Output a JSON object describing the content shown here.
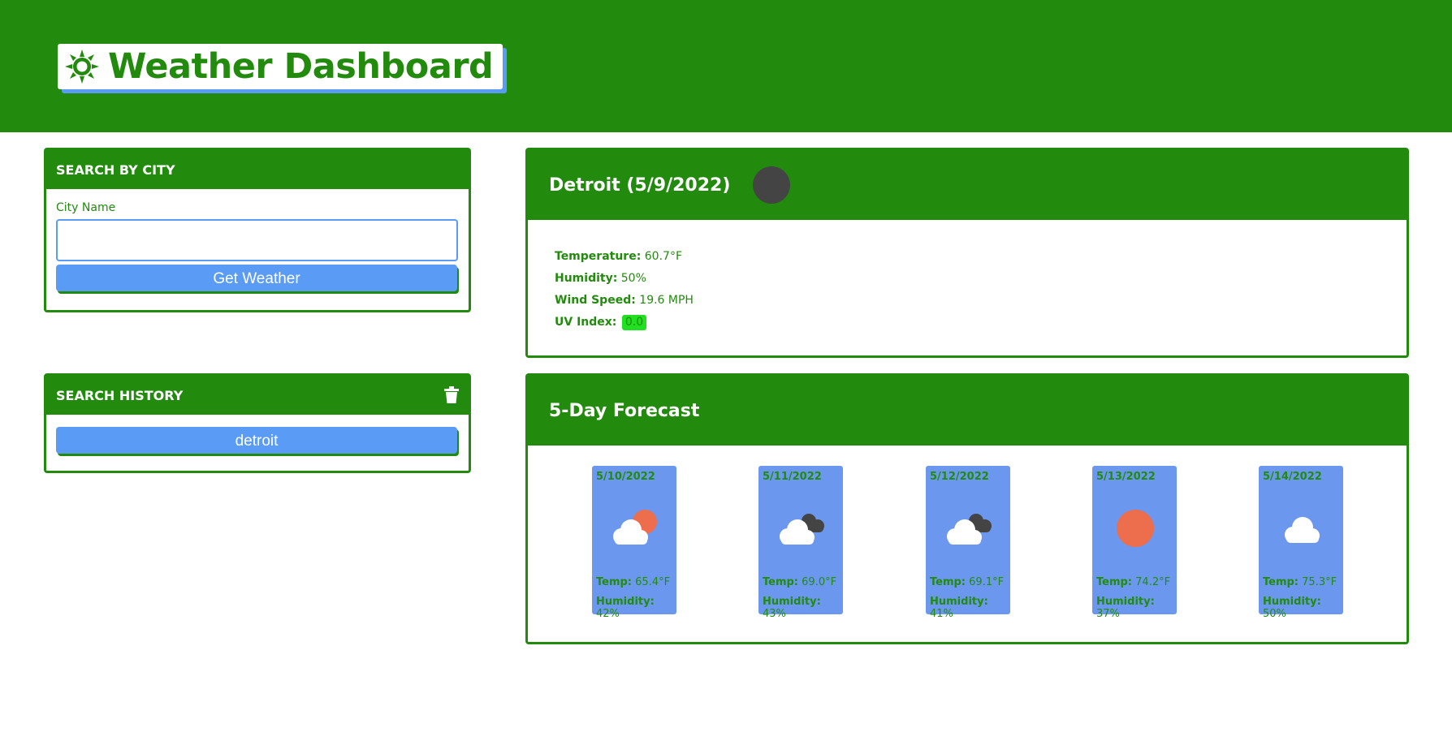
{
  "header": {
    "title": "Weather Dashboard",
    "icon": "sun-icon"
  },
  "search": {
    "title": "SEARCH BY CITY",
    "field_label": "City Name",
    "input_value": "",
    "button_label": "Get Weather"
  },
  "history": {
    "title": "SEARCH HISTORY",
    "clear_icon": "trash-icon",
    "items": [
      "detroit"
    ]
  },
  "current": {
    "heading": "Detroit (5/9/2022)",
    "icon": "weather-icon",
    "temperature_label": "Temperature:",
    "temperature_value": "60.7°F",
    "humidity_label": "Humidity:",
    "humidity_value": "50%",
    "wind_label": "Wind Speed:",
    "wind_value": "19.6 MPH",
    "uv_label": "UV Index:",
    "uv_value": "0.0"
  },
  "forecast": {
    "title": "5-Day Forecast",
    "temp_label": "Temp:",
    "humidity_label": "Humidity:",
    "days": [
      {
        "date": "5/10/2022",
        "icon": "partly-cloudy-icon",
        "temp": "65.4°F",
        "humidity": "42%"
      },
      {
        "date": "5/11/2022",
        "icon": "broken-clouds-icon",
        "temp": "69.0°F",
        "humidity": "43%"
      },
      {
        "date": "5/12/2022",
        "icon": "broken-clouds-icon",
        "temp": "69.1°F",
        "humidity": "41%"
      },
      {
        "date": "5/13/2022",
        "icon": "clear-sky-icon",
        "temp": "74.2°F",
        "humidity": "37%"
      },
      {
        "date": "5/14/2022",
        "icon": "cloud-icon",
        "temp": "75.3°F",
        "humidity": "50%"
      }
    ]
  },
  "colors": {
    "primary_green": "#228b0e",
    "button_blue": "#5a9cf5",
    "card_blue": "#6b98ee",
    "uv_green": "#21e021",
    "sun_orange": "#ec6e4c"
  }
}
